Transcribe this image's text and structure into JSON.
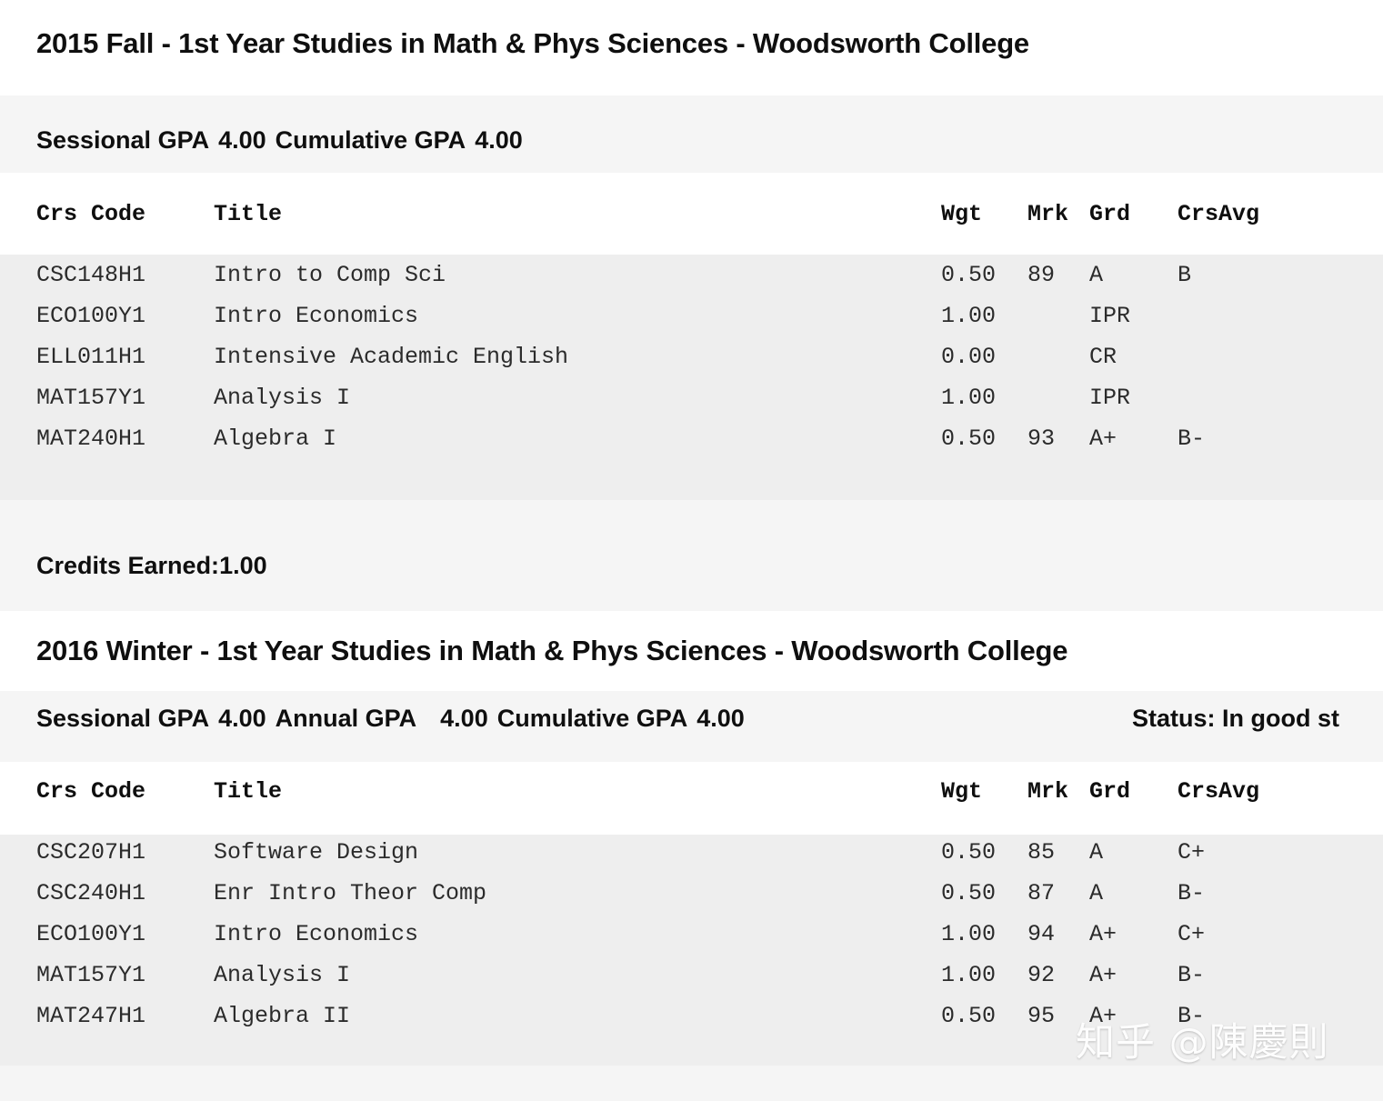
{
  "document": {
    "watermark": "知乎 @陳慶則"
  },
  "table_headers": {
    "crs_code": "Crs Code",
    "title": "Title",
    "wgt": "Wgt",
    "mrk": "Mrk",
    "grd": "Grd",
    "crsavg": "CrsAvg"
  },
  "labels": {
    "sessional_gpa": "Sessional GPA",
    "annual_gpa": "Annual GPA",
    "cumulative_gpa": "Cumulative GPA",
    "credits_earned": "Credits Earned:"
  },
  "sections": [
    {
      "title": "2015 Fall - 1st Year Studies in Math & Phys Sciences - Woodsworth College",
      "sessional_gpa": "4.00",
      "cumulative_gpa": "4.00",
      "credits_earned": "1.00",
      "courses": [
        {
          "code": "CSC148H1",
          "title": "Intro to Comp Sci",
          "wgt": "0.50",
          "mrk": "89",
          "grd": "A",
          "crsavg": "B"
        },
        {
          "code": "ECO100Y1",
          "title": "Intro Economics",
          "wgt": "1.00",
          "mrk": "",
          "grd": "IPR",
          "crsavg": ""
        },
        {
          "code": "ELL011H1",
          "title": "Intensive Academic English",
          "wgt": "0.00",
          "mrk": "",
          "grd": "CR",
          "crsavg": ""
        },
        {
          "code": "MAT157Y1",
          "title": "Analysis I",
          "wgt": "1.00",
          "mrk": "",
          "grd": "IPR",
          "crsavg": ""
        },
        {
          "code": "MAT240H1",
          "title": "Algebra I",
          "wgt": "0.50",
          "mrk": "93",
          "grd": "A+",
          "crsavg": "B-"
        }
      ]
    },
    {
      "title": "2016 Winter - 1st Year Studies in Math & Phys Sciences - Woodsworth College",
      "sessional_gpa": "4.00",
      "annual_gpa": "4.00",
      "cumulative_gpa": "4.00",
      "status": "Status: In good st",
      "courses": [
        {
          "code": "CSC207H1",
          "title": "Software Design",
          "wgt": "0.50",
          "mrk": "85",
          "grd": "A",
          "crsavg": "C+"
        },
        {
          "code": "CSC240H1",
          "title": "Enr Intro Theor Comp",
          "wgt": "0.50",
          "mrk": "87",
          "grd": "A",
          "crsavg": "B-"
        },
        {
          "code": "ECO100Y1",
          "title": "Intro Economics",
          "wgt": "1.00",
          "mrk": "94",
          "grd": "A+",
          "crsavg": "C+"
        },
        {
          "code": "MAT157Y1",
          "title": "Analysis I",
          "wgt": "1.00",
          "mrk": "92",
          "grd": "A+",
          "crsavg": "B-"
        },
        {
          "code": "MAT247H1",
          "title": "Algebra II",
          "wgt": "0.50",
          "mrk": "95",
          "grd": "A+",
          "crsavg": "B-"
        }
      ]
    }
  ]
}
